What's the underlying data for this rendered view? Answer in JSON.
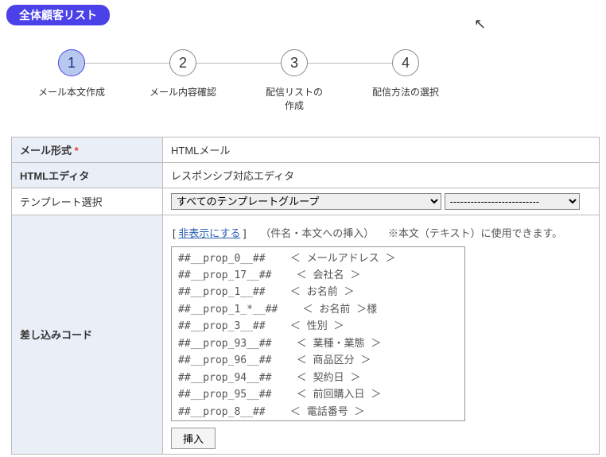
{
  "header": {
    "title": "全体顧客リスト"
  },
  "steps": [
    {
      "num": "1",
      "label": "メール本文作成",
      "active": true
    },
    {
      "num": "2",
      "label": "メール内容確認",
      "active": false
    },
    {
      "num": "3",
      "label": "配信リストの\n作成",
      "active": false
    },
    {
      "num": "4",
      "label": "配信方法の選択",
      "active": false
    }
  ],
  "form": {
    "mail_format_label": "メール形式",
    "mail_format_req": "*",
    "mail_format_value": "HTMLメール",
    "html_editor_label": "HTMLエディタ",
    "html_editor_value": "レスポンシブ対応エディタ",
    "template_label": "テンプレート選択",
    "template_group_value": "すべてのテンプレートグループ",
    "template_second_value": "--------------------------",
    "merge_label": "差し込みコード",
    "hide_link": "非表示にする",
    "merge_note1": "（件名・本文への挿入）",
    "merge_note2": "※本文（テキスト）に使用できます。",
    "insert_button": "挿入"
  },
  "merge_codes": [
    "##__prop_0__##    ＜ メールアドレス ＞",
    "##__prop_17__##    ＜ 会社名 ＞",
    "##__prop_1__##    ＜ お名前 ＞",
    "##__prop_1_*__##    ＜ お名前 ＞様",
    "##__prop_3__##    ＜ 性別 ＞",
    "##__prop_93__##    ＜ 業種・業態 ＞",
    "##__prop_96__##    ＜ 商品区分 ＞",
    "##__prop_94__##    ＜ 契約日 ＞",
    "##__prop_95__##    ＜ 前回購入日 ＞",
    "##__prop_8__##    ＜ 電話番号 ＞"
  ]
}
